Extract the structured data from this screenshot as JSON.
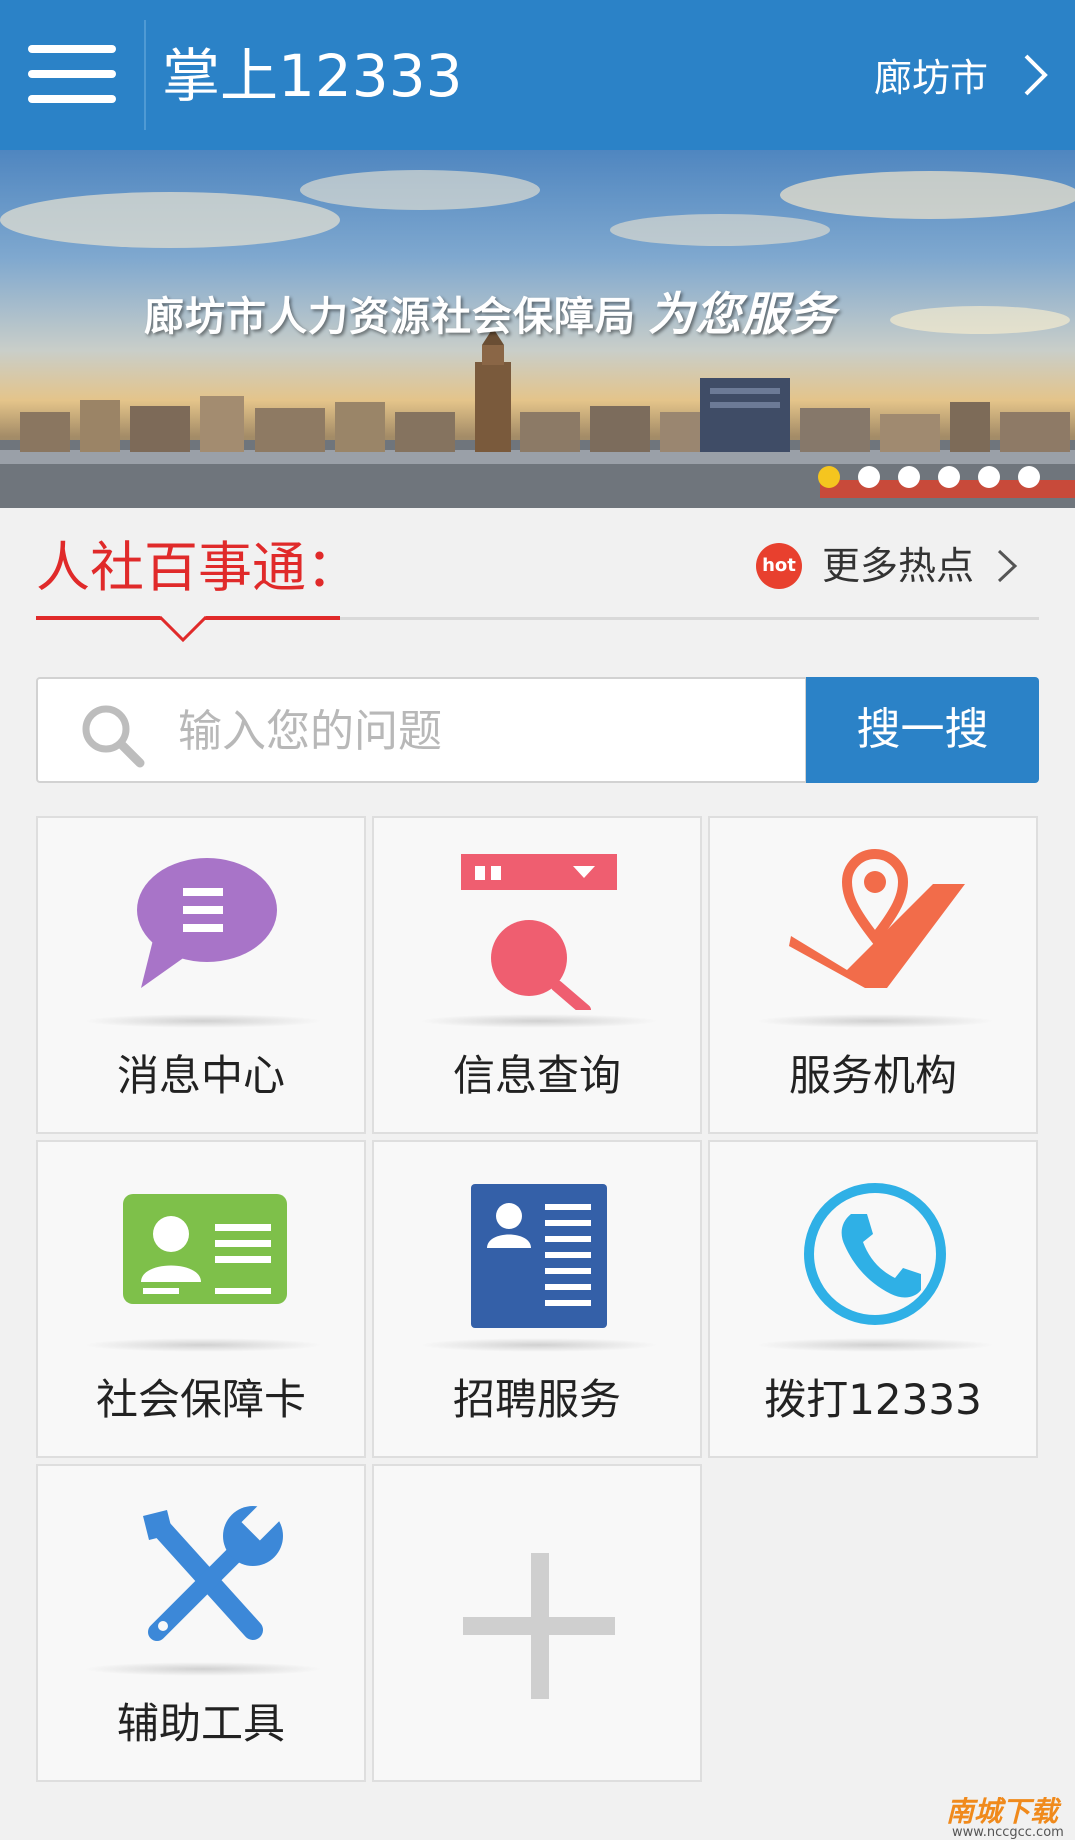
{
  "header": {
    "title": "掌上12333",
    "city": "廊坊市",
    "color": "#2b82c7"
  },
  "banner": {
    "title": "廊坊市人力资源社会保障局",
    "slogan": "为您服务",
    "slides": 6,
    "active_slide": 1
  },
  "section": {
    "title": "人社百事通：",
    "hot_badge": "hot",
    "hot_link": "更多热点",
    "accent": "#e02a2a"
  },
  "search": {
    "placeholder": "输入您的问题",
    "value": "",
    "button": "搜一搜"
  },
  "tiles": [
    {
      "label": "消息中心",
      "icon": "message-bubble-icon"
    },
    {
      "label": "信息查询",
      "icon": "magnifier-query-icon"
    },
    {
      "label": "服务机构",
      "icon": "map-location-icon"
    },
    {
      "label": "社会保障卡",
      "icon": "id-card-icon"
    },
    {
      "label": "招聘服务",
      "icon": "resume-document-icon"
    },
    {
      "label": "拨打12333",
      "icon": "phone-call-icon"
    },
    {
      "label": "辅助工具",
      "icon": "tools-icon"
    },
    {
      "label": "",
      "icon": "add-plus-icon"
    }
  ],
  "watermark": {
    "logo": "南城下载",
    "url": "www.nccgcc.com"
  }
}
